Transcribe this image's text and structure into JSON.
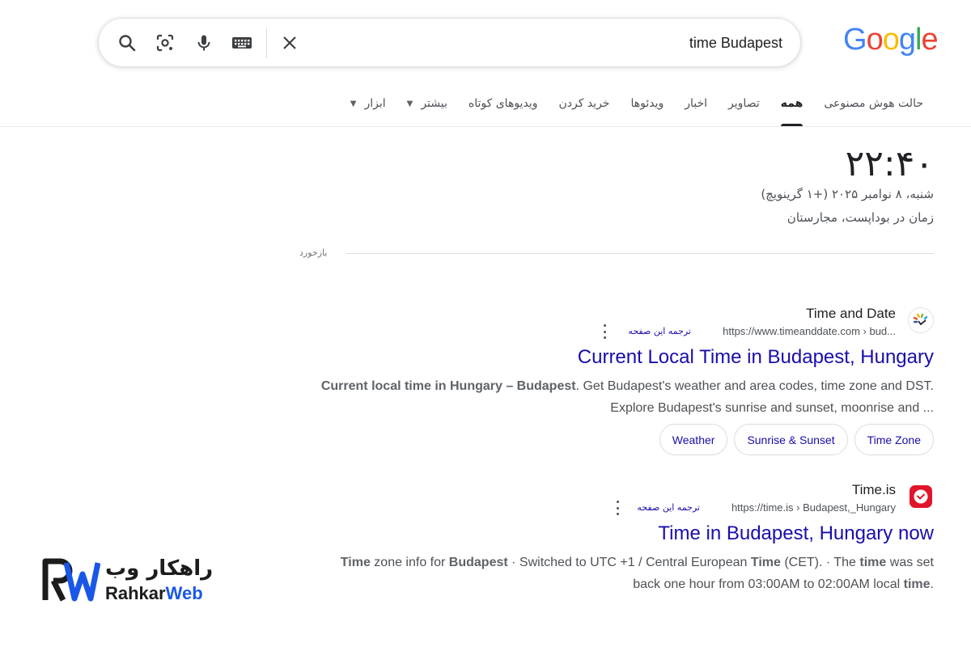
{
  "search": {
    "query": "time Budapest"
  },
  "logo": {
    "text": "Google",
    "letters": [
      "G",
      "o",
      "o",
      "g",
      "l",
      "e"
    ],
    "colors": [
      "#4285F4",
      "#EA4335",
      "#FBBC05",
      "#4285F4",
      "#34A853",
      "#EA4335"
    ]
  },
  "tabs": [
    {
      "label": "حالت هوش مصنوعی",
      "active": false
    },
    {
      "label": "همه",
      "active": true
    },
    {
      "label": "تصاویر",
      "active": false
    },
    {
      "label": "اخبار",
      "active": false
    },
    {
      "label": "ویدئوها",
      "active": false
    },
    {
      "label": "خرید کردن",
      "active": false
    },
    {
      "label": "ویدیوهای کوتاه",
      "active": false
    },
    {
      "label": "بیشتر",
      "active": false,
      "dropdown": true
    },
    {
      "label": "ابزار",
      "active": false,
      "dropdown": true
    }
  ],
  "clock": {
    "time": "۲۲:۴۰",
    "date": "شنبه، ۸ نوامبر ۲۰۲۵ (+۱ گرینویچ)",
    "place": "زمان در بوداپست، مجارستان",
    "feedback": "بازخورد"
  },
  "results": [
    {
      "site_name": "Time and Date",
      "url": "https://www.timeanddate.com › bud...",
      "translate": "ترجمه این صفحه",
      "title": "Current Local Time in Budapest, Hungary",
      "snippet_html": "<b>Current local time in Hungary – Budapest</b>. Get Budapest's weather and area codes, time zone and DST. Explore Budapest's sunrise and sunset, moonrise and ...",
      "chips": [
        "Time Zone",
        "Sunrise & Sunset",
        "Weather"
      ],
      "favicon": "timeanddate-icon"
    },
    {
      "site_name": "Time.is",
      "url": "https://time.is › Budapest,_Hungary",
      "translate": "ترجمه این صفحه",
      "title": "Time in Budapest, Hungary now",
      "snippet_html": "<b>Time</b> zone info for <b>Budapest</b> · Switched to UTC +1 / Central European <b>Time</b> (CET). · The <b>time</b> was set back one hour from 03:00AM to 02:00AM local <b>time</b>.",
      "chips": [],
      "favicon": "timeis-icon"
    }
  ],
  "watermark": {
    "fa": "راهکار وب",
    "en_part1": "Rahkar",
    "en_part2": "Web"
  }
}
